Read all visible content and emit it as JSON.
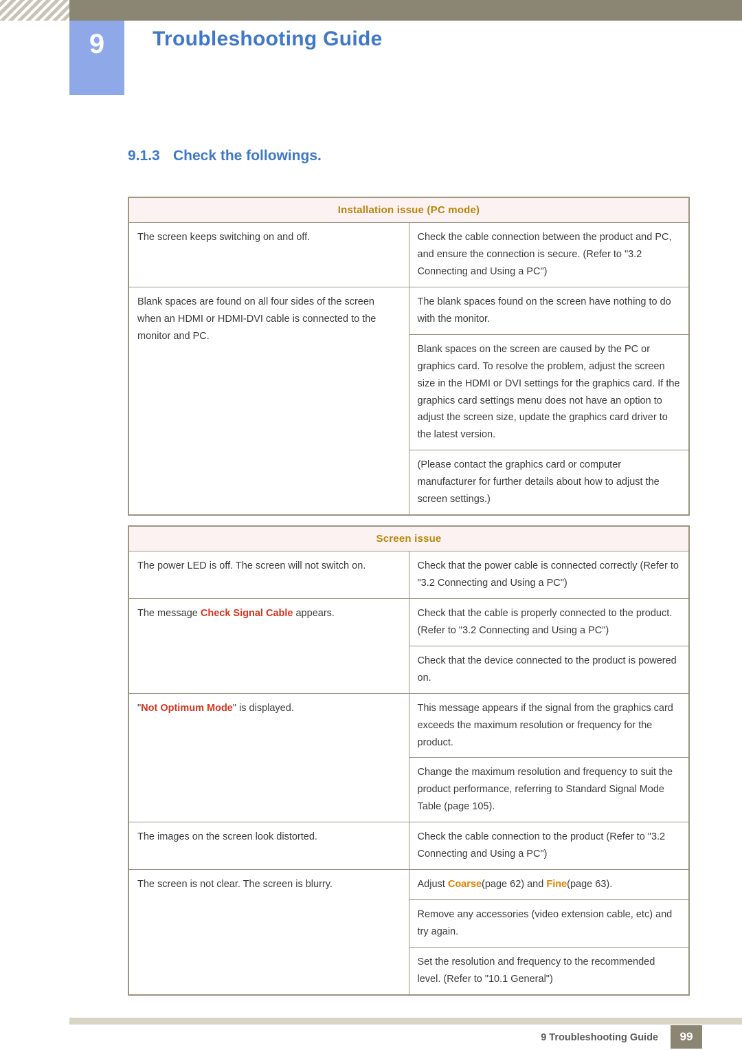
{
  "header": {
    "chapter_number": "9",
    "chapter_title": "Troubleshooting Guide"
  },
  "section": {
    "number": "9.1.3",
    "title": "Check the followings."
  },
  "tables": [
    {
      "id": "install",
      "header": "Installation issue (PC mode)",
      "rows": [
        {
          "left": "The screen keeps switching on and off.",
          "right_blocks": [
            "Check the cable connection between the product and PC, and ensure the connection is secure. (Refer to \"3.2 Connecting and Using a PC\")"
          ]
        },
        {
          "left": "Blank spaces are found on all four sides of the screen when an HDMI or HDMI-DVI cable is connected to the monitor and PC.",
          "right_blocks": [
            "The blank spaces found on the screen have nothing to do with the monitor.",
            "Blank spaces on the screen are caused by the PC or graphics card. To resolve the problem, adjust the screen size in the HDMI or DVI settings for the graphics card. If the graphics card settings menu does not have an option to adjust the screen size, update the graphics card driver to the latest version.",
            "(Please contact the graphics card or computer manufacturer for further details about how to adjust the screen settings.)"
          ]
        }
      ]
    },
    {
      "id": "screen",
      "header": "Screen issue",
      "rows": [
        {
          "left": "The power LED is off. The screen will not switch on.",
          "right_blocks": [
            "Check that the power cable is connected correctly (Refer to \"3.2 Connecting and Using a PC\")"
          ]
        },
        {
          "left_pre": "The message ",
          "left_hl": "Check Signal Cable",
          "left_post": " appears.",
          "right_blocks": [
            "Check that the cable is properly connected to the product. (Refer to \"3.2 Connecting and Using a PC\")",
            "Check that the device connected to the product is powered on."
          ]
        },
        {
          "left_pre": "\"",
          "left_hl": "Not Optimum Mode",
          "left_post": "\" is displayed.",
          "right_blocks": [
            "This message appears if the signal from the graphics card exceeds the maximum resolution or frequency for the product.",
            "Change the maximum resolution and frequency to suit the product performance, referring to Standard Signal Mode Table (page 105)."
          ]
        },
        {
          "left": "The images on the screen look distorted.",
          "right_blocks": [
            "Check the cable connection to the product (Refer to \"3.2 Connecting and Using a PC\")"
          ]
        },
        {
          "left": "The screen is not clear. The screen is blurry.",
          "right_adjust": {
            "pre": "Adjust ",
            "hl1": "Coarse",
            "mid": "(page 62) and ",
            "hl2": "Fine",
            "post": "(page 63)."
          },
          "right_blocks": [
            "Remove any accessories (video extension cable, etc) and try again.",
            "Set the resolution and frequency to the recommended level. (Refer to \"10.1 General\")"
          ]
        }
      ]
    }
  ],
  "footer": {
    "text": "9 Troubleshooting Guide",
    "page": "99"
  },
  "colors": {
    "accent_blue": "#3f78c8",
    "badge_blue": "#8ea8e8",
    "header_bar": "#8b8574",
    "table_border": "#9a9480",
    "table_head_bg": "#fdf2f2",
    "table_head_text": "#b8860b",
    "highlight_red": "#d4341f",
    "highlight_orange": "#e08000"
  }
}
